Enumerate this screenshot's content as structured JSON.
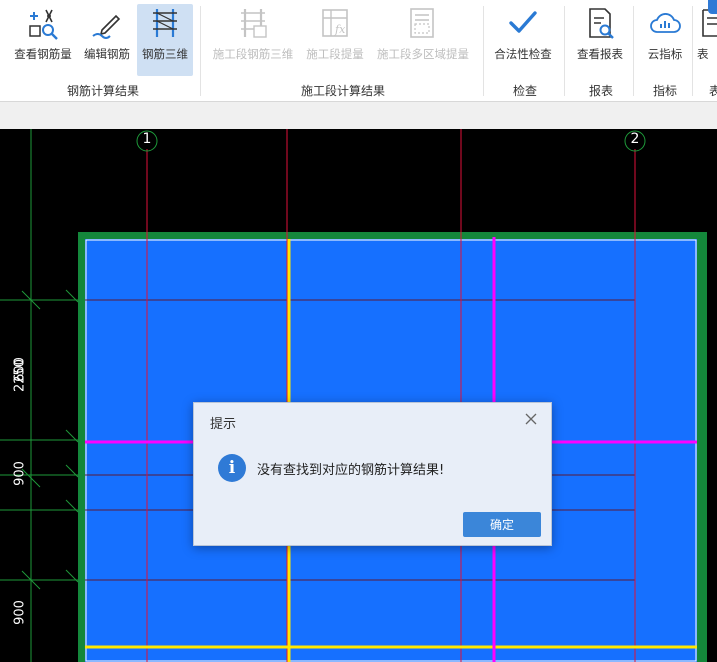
{
  "ribbon": {
    "groups": [
      {
        "label": "钢筋计算结果",
        "items": [
          {
            "label": "查看钢筋量",
            "icon": "view-rebar-quantity-icon"
          },
          {
            "label": "编辑钢筋",
            "icon": "edit-rebar-icon"
          },
          {
            "label": "钢筋三维",
            "icon": "rebar-3d-icon",
            "active": true
          }
        ]
      },
      {
        "label": "施工段计算结果",
        "items": [
          {
            "label": "施工段钢筋三维",
            "icon": "segment-rebar-3d-icon",
            "disabled": true
          },
          {
            "label": "施工段提量",
            "icon": "segment-quantity-icon",
            "disabled": true
          },
          {
            "label": "施工段多区域提量",
            "icon": "segment-multi-area-icon",
            "disabled": true
          }
        ]
      },
      {
        "label": "检查",
        "items": [
          {
            "label": "合法性检查",
            "icon": "checkmark-icon"
          }
        ]
      },
      {
        "label": "报表",
        "items": [
          {
            "label": "查看报表",
            "icon": "report-icon"
          }
        ]
      },
      {
        "label": "指标",
        "items": [
          {
            "label": "云指标",
            "icon": "cloud-index-icon"
          }
        ]
      },
      {
        "label": "表",
        "items": [
          {
            "label": "表",
            "icon": "table-icon"
          }
        ]
      }
    ]
  },
  "canvas": {
    "axis_labels": [
      "1",
      "2"
    ],
    "dimensions": [
      "2250",
      "900",
      "900",
      "600"
    ]
  },
  "dialog": {
    "title": "提示",
    "message": "没有查找到对应的钢筋计算结果!",
    "ok_label": "确定"
  },
  "colors": {
    "slab_fill": "#1670ff",
    "slab_border": "#14873b",
    "axis_line": "#e0103a",
    "beam_yellow": "#ffe800",
    "beam_magenta": "#ff00ff",
    "accent": "#3b86d9"
  }
}
